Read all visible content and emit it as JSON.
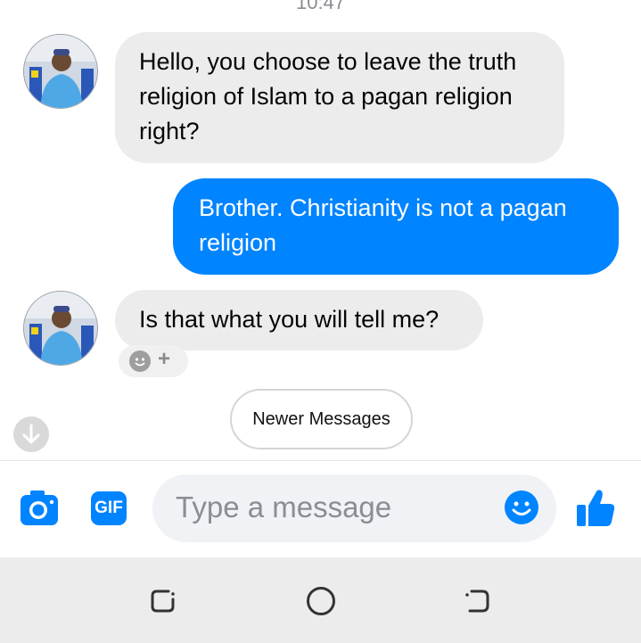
{
  "status": {
    "time_partial": "10:47"
  },
  "messages": [
    {
      "direction": "incoming",
      "text": "Hello, you choose to leave the truth religion of Islam to a pagan religion right?"
    },
    {
      "direction": "outgoing",
      "text": "Brother. Christianity is not a pagan religion"
    },
    {
      "direction": "incoming",
      "text": "Is that what you will tell me?"
    }
  ],
  "reaction": {
    "plus": "+"
  },
  "newer_messages_label": "Newer Messages",
  "composer": {
    "placeholder": "Type a message",
    "gif_label": "GIF",
    "icons": [
      "camera-icon",
      "gif-icon",
      "emoji-icon",
      "thumbs-up-icon"
    ]
  },
  "nav": {
    "icons": [
      "recent-apps-icon",
      "home-icon",
      "back-icon"
    ]
  },
  "colors": {
    "accent": "#0084ff",
    "incoming_bubble": "#ececec",
    "outgoing_text": "#ffffff"
  }
}
